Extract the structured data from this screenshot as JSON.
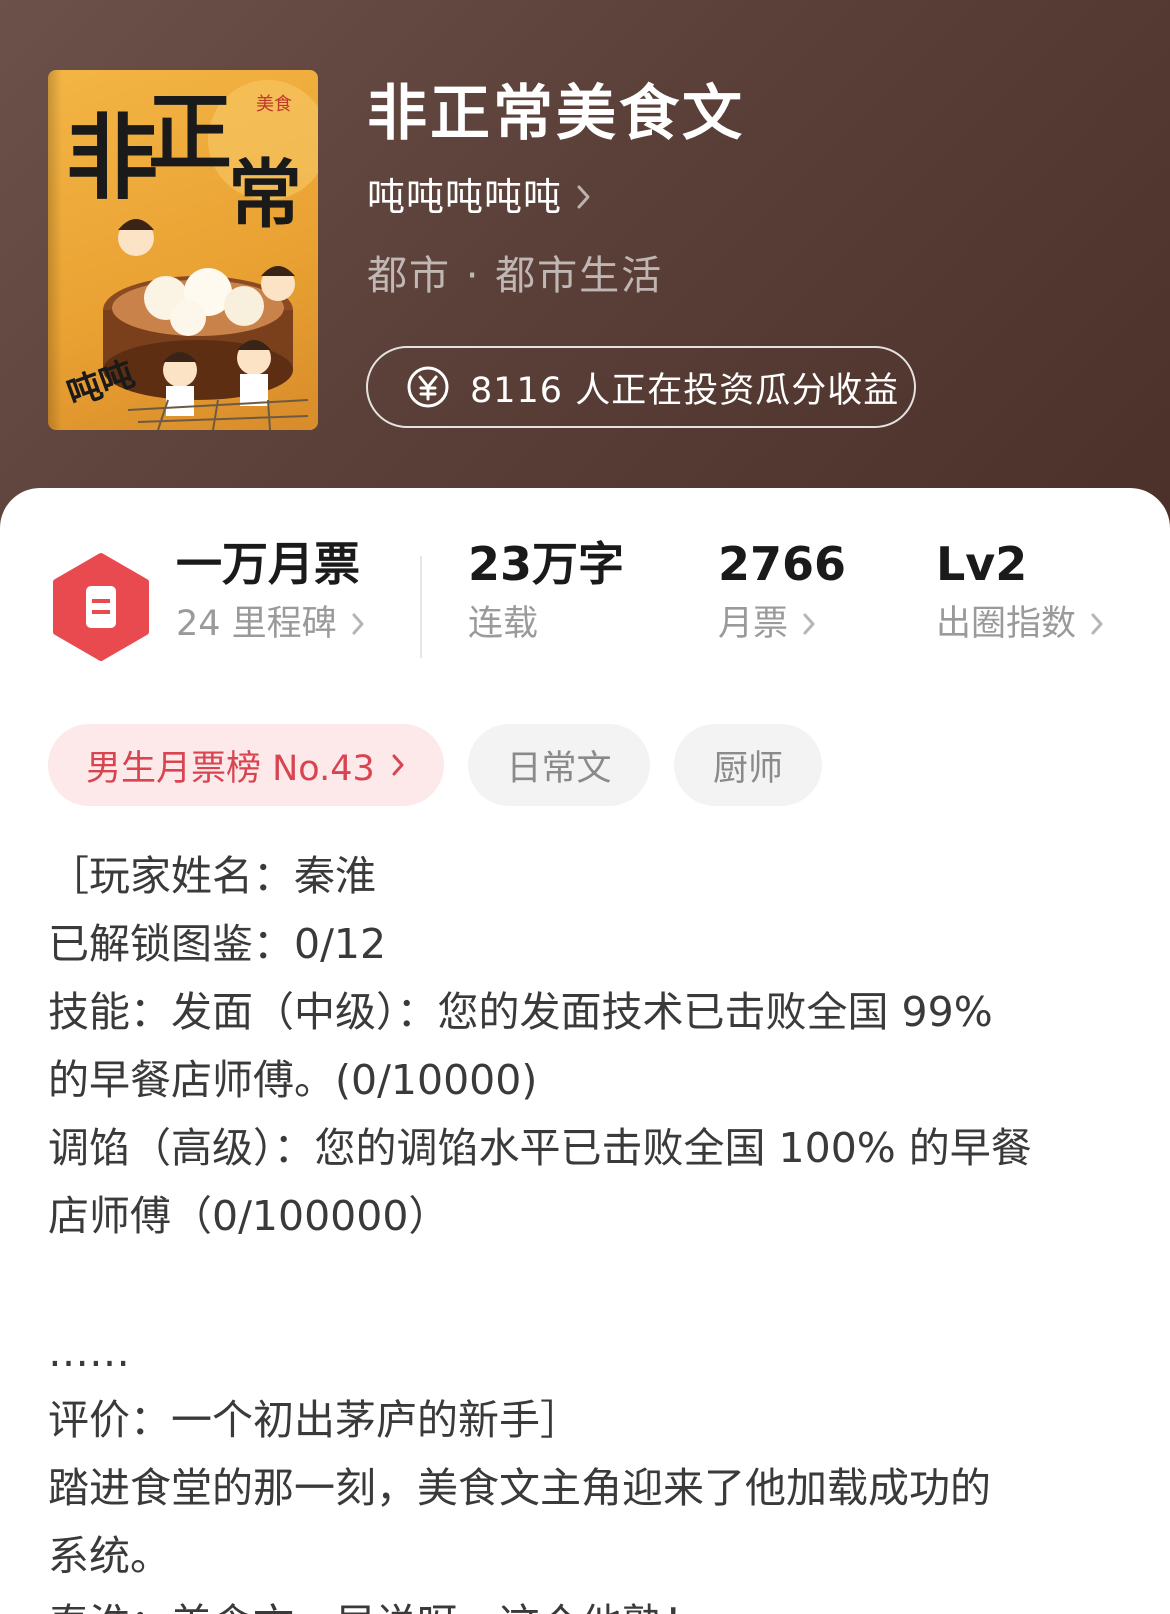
{
  "book": {
    "title": "非正常美食文",
    "author": "吨吨吨吨吨",
    "genre": "都市 · 都市生活",
    "investment_text": "8116 人正在投资瓜分收益"
  },
  "cover": {
    "title_chars": [
      "非",
      "正",
      "常"
    ],
    "badge": "美食",
    "author_sign": "吨吨"
  },
  "stats": {
    "monthly_tickets_milestone": {
      "value": "一万月票",
      "label": "24 里程碑"
    },
    "word_count": {
      "value": "23万字",
      "label": "连载"
    },
    "monthly_tickets": {
      "value": "2766",
      "label": "月票"
    },
    "popularity": {
      "value": "Lv2",
      "label": "出圈指数"
    }
  },
  "tags": {
    "rank": "男生月票榜 No.43",
    "tag1": "日常文",
    "tag2": "厨师"
  },
  "description_lines": [
    "［玩家姓名：秦淮",
    "已解锁图鉴：0/12",
    "技能：发面（中级）：您的发面技术已击败全国 99%",
    "的早餐店师傅。(0/10000)",
    "调馅（高级）：您的调馅水平已击败全国 100% 的早餐",
    "店师傅（0/100000）",
    "",
    "……",
    "评价：一个初出茅庐的新手］",
    "踏进食堂的那一刻，美食文主角迎来了他加载成功的",
    "系统。",
    "秦淮：美食文，早说呀，这个他熟！"
  ],
  "colors": {
    "header_bg": "#5a4038",
    "rank_tag_bg": "#fde9ea",
    "rank_tag_text": "#d84550",
    "ticket_icon": "#e84a50"
  },
  "icons": {
    "ticket": "ticket-icon",
    "coin": "yuan-coin-icon",
    "chevron": "chevron-right-icon"
  }
}
